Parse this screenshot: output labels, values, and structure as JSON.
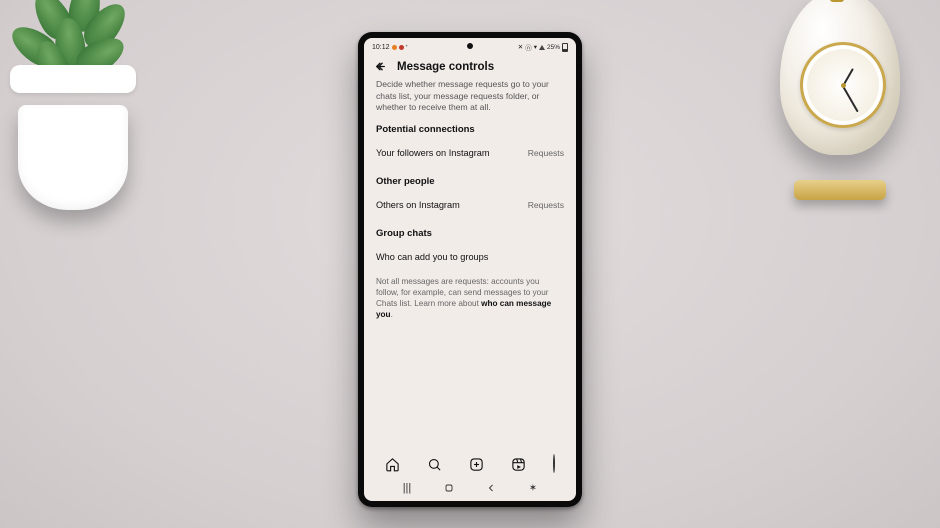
{
  "statusbar": {
    "time": "10:12",
    "battery_text": "25%"
  },
  "header": {
    "title": "Message controls"
  },
  "description": "Decide whether message requests go to your chats list, your message requests folder, or whether to receive them at all.",
  "sections": {
    "potential": {
      "heading": "Potential connections",
      "row_label": "Your followers on Instagram",
      "row_value": "Requests"
    },
    "other": {
      "heading": "Other people",
      "row_label": "Others on Instagram",
      "row_value": "Requests"
    },
    "groups": {
      "heading": "Group chats",
      "row_label": "Who can add you to groups"
    }
  },
  "footnote": {
    "text_a": "Not all messages are requests: accounts you follow, for example, can send messages to your Chats list. Learn more about ",
    "link": "who can message you",
    "text_b": "."
  },
  "tabs": {
    "home": "home-icon",
    "search": "search-icon",
    "create": "create-icon",
    "reels": "reels-icon",
    "profile": "profile-avatar"
  }
}
